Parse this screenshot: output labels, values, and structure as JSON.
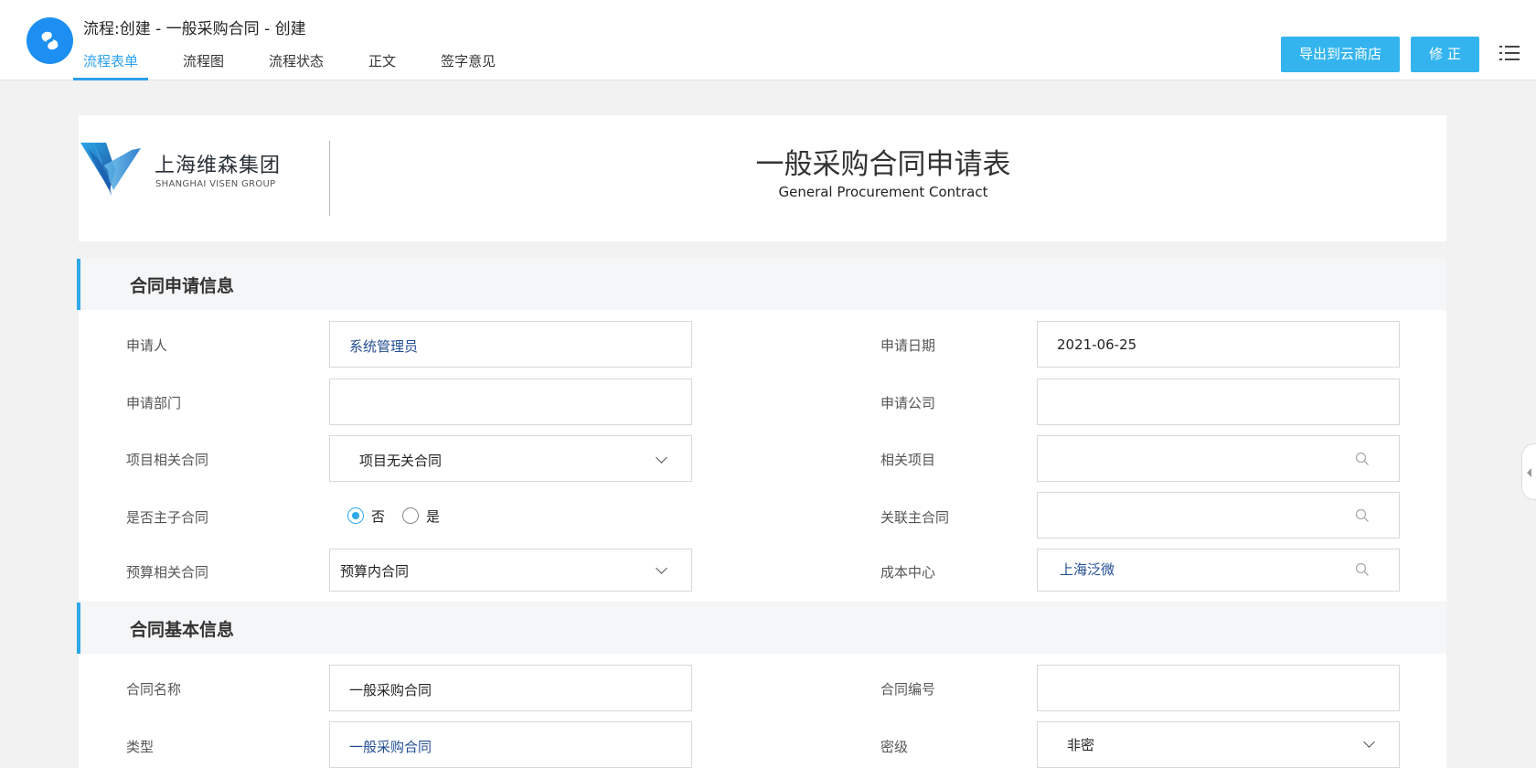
{
  "header": {
    "title": "流程:创建 - 一般采购合同 - 创建",
    "tabs": [
      {
        "label": "流程表单",
        "active": true
      },
      {
        "label": "流程图",
        "active": false
      },
      {
        "label": "流程状态",
        "active": false
      },
      {
        "label": "正文",
        "active": false
      },
      {
        "label": "签字意见",
        "active": false
      }
    ],
    "export_button": "导出到云商店",
    "revise_button": "修 正",
    "icons": {
      "app_logo": "app-logo-icon",
      "menu": "list-menu-icon"
    }
  },
  "document": {
    "company_name_cn": "上海维森集团",
    "company_name_en": "SHANGHAI VISEN GROUP",
    "form_title": "一般采购合同申请表",
    "form_subtitle": "General Procurement Contract"
  },
  "sections": {
    "apply": {
      "title": "合同申请信息",
      "applicant_label": "申请人",
      "applicant_value": "系统管理员",
      "apply_date_label": "申请日期",
      "apply_date_value": "2021-06-25",
      "dept_label": "申请部门",
      "dept_value": "",
      "company_label": "申请公司",
      "company_value": "",
      "project_contract_label": "项目相关合同",
      "project_contract_value": "项目无关合同",
      "related_project_label": "相关项目",
      "related_project_value": "",
      "is_main_label": "是否主子合同",
      "is_main_options": [
        "否",
        "是"
      ],
      "is_main_selected": "否",
      "related_main_label": "关联主合同",
      "related_main_value": "",
      "budget_label": "预算相关合同",
      "budget_value": "预算内合同",
      "cost_center_label": "成本中心",
      "cost_center_value": "上海泛微"
    },
    "basic": {
      "title": "合同基本信息",
      "name_label": "合同名称",
      "name_value": "一般采购合同",
      "number_label": "合同编号",
      "number_value": "",
      "type_label": "类型",
      "type_value": "一般采购合同",
      "secret_label": "密级",
      "secret_value": "非密"
    }
  },
  "colors": {
    "accent": "#2fa8ea",
    "button": "#33b4ef",
    "link_value": "#224e93",
    "logo_blue": "#1d8ff2"
  }
}
